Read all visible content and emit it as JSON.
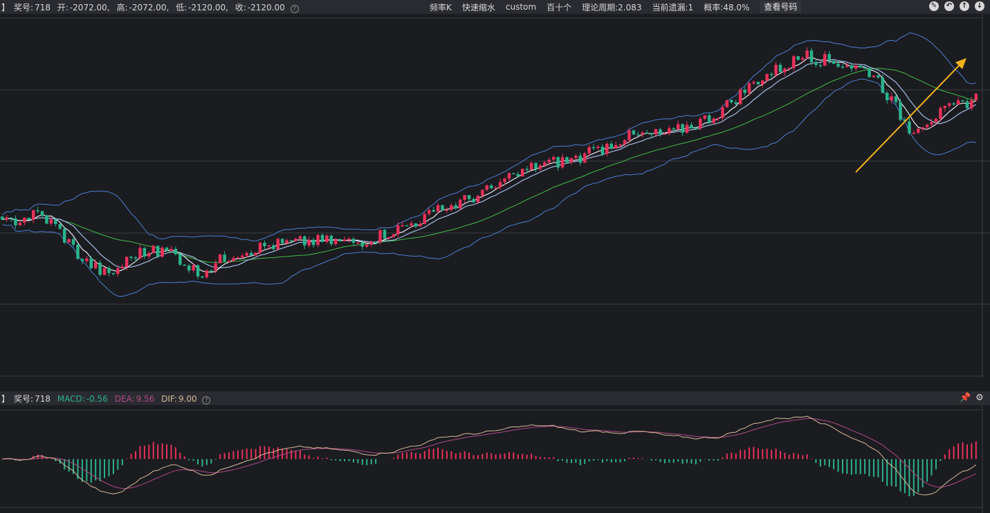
{
  "top_bar": {
    "prefix": "】",
    "award_label": "奖号:",
    "award_value": "718",
    "open_label": "开:",
    "open_value": "-2072.00,",
    "high_label": "高:",
    "high_value": "-2072.00,",
    "low_label": "低:",
    "low_value": "-2120.00,",
    "close_label": "收:",
    "close_value": "-2120.00",
    "info_items": [
      "频率K",
      "快速缩水",
      "custom",
      "百十个",
      "理论周期:2.083",
      "当前遗漏:1",
      "概率:48.0%"
    ],
    "query_button": "查看号码",
    "icons": [
      "edit-icon",
      "back-icon",
      "up-icon",
      "down-icon"
    ]
  },
  "sub_bar": {
    "prefix": "】",
    "award_label": "奖号:",
    "award_value": "718",
    "macd_label": "MACD:",
    "macd_value": "-0.56",
    "dea_label": "DEA:",
    "dea_value": "9.56",
    "dif_label": "DIF:",
    "dif_value": "9.00",
    "icons": [
      "pin-icon",
      "gear-icon"
    ]
  },
  "colors": {
    "up": "#e8315a",
    "down": "#2bb38c",
    "ma_fast": "#e8eaf2",
    "ma_mid": "#9ab3d8",
    "ma_slow": "#3fbf49",
    "band": "#4a7fd4",
    "arrow": "#f2b21b",
    "dif": "#d6b99a",
    "dea": "#b04a85"
  },
  "chart_data": [
    {
      "type": "candlestick",
      "title": "",
      "x_range": [
        0,
        220
      ],
      "y_range": [
        -2550,
        -1950
      ],
      "series_names": [],
      "path": [
        [
          0,
          2
        ],
        [
          10,
          -6
        ],
        [
          20,
          14
        ],
        [
          40,
          -6
        ],
        [
          55,
          4
        ],
        [
          65,
          0
        ],
        [
          80,
          -6
        ],
        [
          95,
          0
        ],
        [
          110,
          6
        ],
        [
          130,
          -4
        ],
        [
          150,
          4
        ],
        [
          160,
          -4
        ],
        [
          180,
          8
        ],
        [
          200,
          4
        ],
        [
          220,
          -2
        ]
      ],
      "trend_points": [
        [
          0,
          -2297
        ],
        [
          8,
          -2280
        ],
        [
          12,
          -2300
        ],
        [
          18,
          -2355
        ],
        [
          24,
          -2383
        ],
        [
          30,
          -2345
        ],
        [
          38,
          -2342
        ],
        [
          44,
          -2378
        ],
        [
          52,
          -2345
        ],
        [
          60,
          -2332
        ],
        [
          70,
          -2325
        ],
        [
          80,
          -2327
        ],
        [
          90,
          -2302
        ],
        [
          100,
          -2270
        ],
        [
          110,
          -2240
        ],
        [
          120,
          -2200
        ],
        [
          130,
          -2188
        ],
        [
          140,
          -2153
        ],
        [
          150,
          -2148
        ],
        [
          160,
          -2118
        ],
        [
          170,
          -2058
        ],
        [
          180,
          -2020
        ],
        [
          190,
          -2033
        ],
        [
          196,
          -2048
        ],
        [
          204,
          -2140
        ],
        [
          210,
          -2118
        ],
        [
          220,
          -2085
        ]
      ]
    },
    {
      "type": "macd",
      "title": "",
      "series_names": []
    }
  ]
}
